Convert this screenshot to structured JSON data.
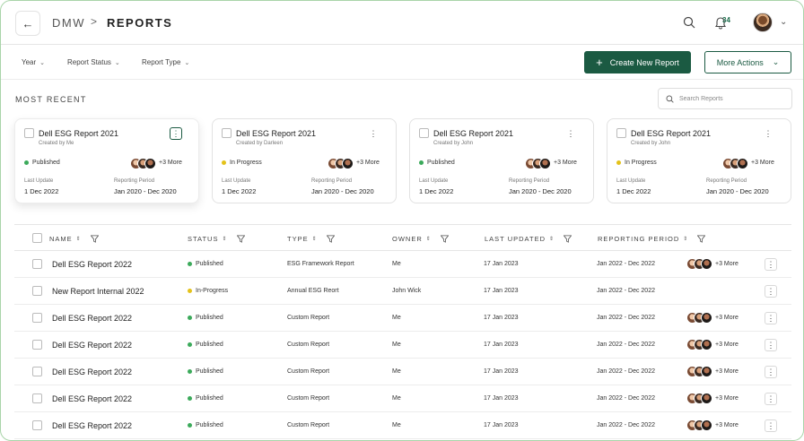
{
  "header": {
    "back_icon": "arrow-left-icon",
    "breadcrumb": [
      "DMW",
      "REPORTS"
    ],
    "separator": ">",
    "notification_count": "34"
  },
  "filters": {
    "items": [
      "Year",
      "Report Status",
      "Report Type"
    ],
    "create_label": "Create New Report",
    "more_actions_label": "More Actions"
  },
  "recent": {
    "title": "MOST RECENT",
    "search_placeholder": "Search Reports",
    "cards": [
      {
        "title": "Dell ESG Report 2021",
        "created_by": "Created by Me",
        "status": "Published",
        "status_color": "#3caa5b",
        "more": "+3 More",
        "last_update_label": "Last Update",
        "last_update": "1 Dec 2022",
        "period_label": "Reporting Period",
        "period": "Jan 2020  - Dec 2020"
      },
      {
        "title": "Dell ESG Report 2021",
        "created_by": "Created by Darleen",
        "status": "In Progress",
        "status_color": "#e4c21a",
        "more": "+3 More",
        "last_update_label": "Last Update",
        "last_update": "1 Dec 2022",
        "period_label": "Reporting Period",
        "period": "Jan 2020  - Dec 2020"
      },
      {
        "title": "Dell ESG Report 2021",
        "created_by": "Created by John",
        "status": "Published",
        "status_color": "#3caa5b",
        "more": "+3 More",
        "last_update_label": "Last Update",
        "last_update": "1 Dec 2022",
        "period_label": "Reporting Period",
        "period": "Jan 2020  - Dec 2020"
      },
      {
        "title": "Dell ESG Report 2021",
        "created_by": "Created by John",
        "status": "In Progress",
        "status_color": "#e4c21a",
        "more": "+3 More",
        "last_update_label": "Last Update",
        "last_update": "1 Dec 2022",
        "period_label": "Reporting Period",
        "period": "Jan 2020  - Dec 2020"
      }
    ]
  },
  "table": {
    "columns": [
      "NAME",
      "STATUS",
      "TYPE",
      "OWNER",
      "LAST UPDATED",
      "REPORTING PERIOD"
    ],
    "rows": [
      {
        "name": "Dell ESG Report 2022",
        "status": "Published",
        "status_color": "#3caa5b",
        "type": "ESG Framework Report",
        "owner": "Me",
        "updated": "17 Jan 2023",
        "period": "Jan 2022 - Dec 2022",
        "more": "+3 More"
      },
      {
        "name": "New Report Internal 2022",
        "status": "In-Progress",
        "status_color": "#e4c21a",
        "type": "Annual ESG Reort",
        "owner": "John Wick",
        "updated": "17 Jan 2023",
        "period": "Jan 2022 - Dec 2022",
        "more": ""
      },
      {
        "name": "Dell ESG Report 2022",
        "status": "Published",
        "status_color": "#3caa5b",
        "type": "Custom Report",
        "owner": "Me",
        "updated": "17 Jan 2023",
        "period": "Jan 2022 - Dec 2022",
        "more": "+3 More"
      },
      {
        "name": "Dell ESG Report 2022",
        "status": "Published",
        "status_color": "#3caa5b",
        "type": "Custom Report",
        "owner": "Me",
        "updated": "17 Jan 2023",
        "period": "Jan 2022 - Dec 2022",
        "more": "+3 More"
      },
      {
        "name": "Dell ESG Report 2022",
        "status": "Published",
        "status_color": "#3caa5b",
        "type": "Custom Report",
        "owner": "Me",
        "updated": "17 Jan 2023",
        "period": "Jan 2022 - Dec 2022",
        "more": "+3 More"
      },
      {
        "name": "Dell ESG Report 2022",
        "status": "Published",
        "status_color": "#3caa5b",
        "type": "Custom Report",
        "owner": "Me",
        "updated": "17 Jan 2023",
        "period": "Jan 2022 - Dec 2022",
        "more": "+3 More"
      },
      {
        "name": "Dell ESG Report 2022",
        "status": "Published",
        "status_color": "#3caa5b",
        "type": "Custom Report",
        "owner": "Me",
        "updated": "17 Jan 2023",
        "period": "Jan 2022 - Dec 2022",
        "more": "+3 More"
      }
    ]
  },
  "colors": {
    "accent": "#1b5a42",
    "published": "#3caa5b",
    "in_progress": "#e4c21a"
  }
}
